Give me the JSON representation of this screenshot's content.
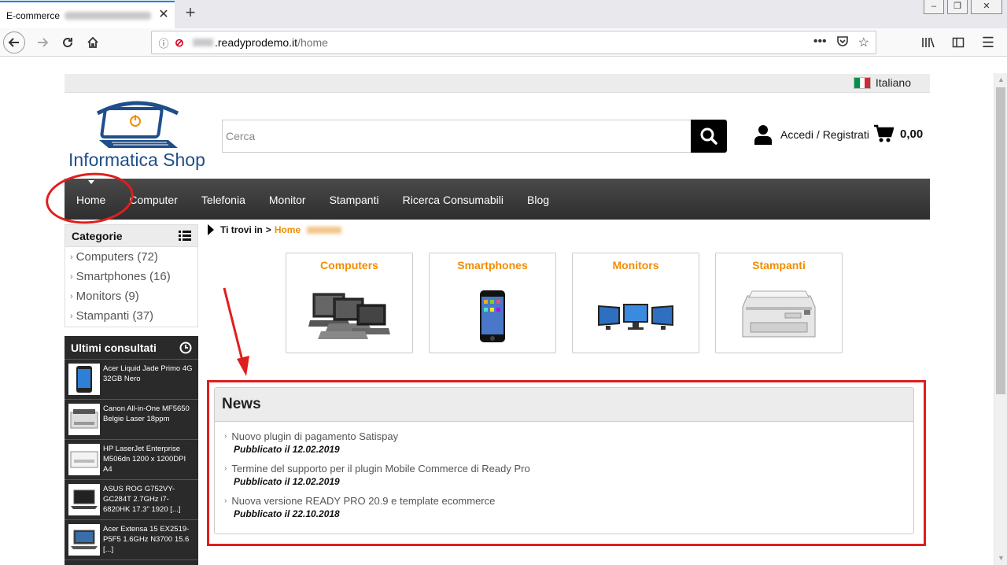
{
  "browser": {
    "tab_title": "E-commerce",
    "new_tab_symbol": "+",
    "url_domain": ".readyprodemo.it",
    "url_path": "/home"
  },
  "topbar": {
    "language": "Italiano"
  },
  "header": {
    "logo_text": "Informatica Shop",
    "search_placeholder": "Cerca",
    "account_label": "Accedi / Registrati",
    "cart_total": "0,00"
  },
  "menu": {
    "items": [
      {
        "label": "Home"
      },
      {
        "label": "Computer"
      },
      {
        "label": "Telefonia"
      },
      {
        "label": "Monitor"
      },
      {
        "label": "Stampanti"
      },
      {
        "label": "Ricerca Consumabili"
      },
      {
        "label": "Blog"
      }
    ]
  },
  "breadcrumb": {
    "prefix": "Ti trovi in",
    "separator": ">",
    "home": "Home"
  },
  "sidebar": {
    "categories_title": "Categorie",
    "categories": [
      {
        "label": "Computers (72)"
      },
      {
        "label": "Smartphones (16)"
      },
      {
        "label": "Monitors (9)"
      },
      {
        "label": "Stampanti (37)"
      }
    ],
    "recent_title": "Ultimi consultati",
    "recent": [
      {
        "label": "Acer Liquid Jade Primo 4G 32GB Nero"
      },
      {
        "label": "Canon All-in-One MF5650 Belgie Laser 18ppm"
      },
      {
        "label": "HP LaserJet Enterprise M506dn 1200 x 1200DPI A4"
      },
      {
        "label": "ASUS ROG G752VY-GC284T 2.7GHz i7-6820HK 17.3\" 1920 [...]"
      },
      {
        "label": "Acer Extensa 15 EX2519-P5F5 1.6GHz N3700 15.6 [...]"
      }
    ]
  },
  "cards": [
    {
      "title": "Computers",
      "icon": "laptops-icon"
    },
    {
      "title": "Smartphones",
      "icon": "smartphone-icon"
    },
    {
      "title": "Monitors",
      "icon": "monitors-icon"
    },
    {
      "title": "Stampanti",
      "icon": "printer-icon"
    }
  ],
  "news": {
    "title": "News",
    "items": [
      {
        "title": "Nuovo plugin di pagamento Satispay",
        "date": "Pubblicato il 12.02.2019"
      },
      {
        "title": "Termine del supporto per il plugin Mobile Commerce di Ready Pro",
        "date": "Pubblicato il 12.02.2019"
      },
      {
        "title": "Nuova versione READY PRO 20.9 e template ecommerce",
        "date": "Pubblicato il 22.10.2018"
      }
    ]
  },
  "colors": {
    "accent_orange": "#f28d00",
    "menu_bg": "#3a3a3a",
    "annotation_red": "#e01e1e",
    "logo_blue": "#1f4e8a"
  }
}
